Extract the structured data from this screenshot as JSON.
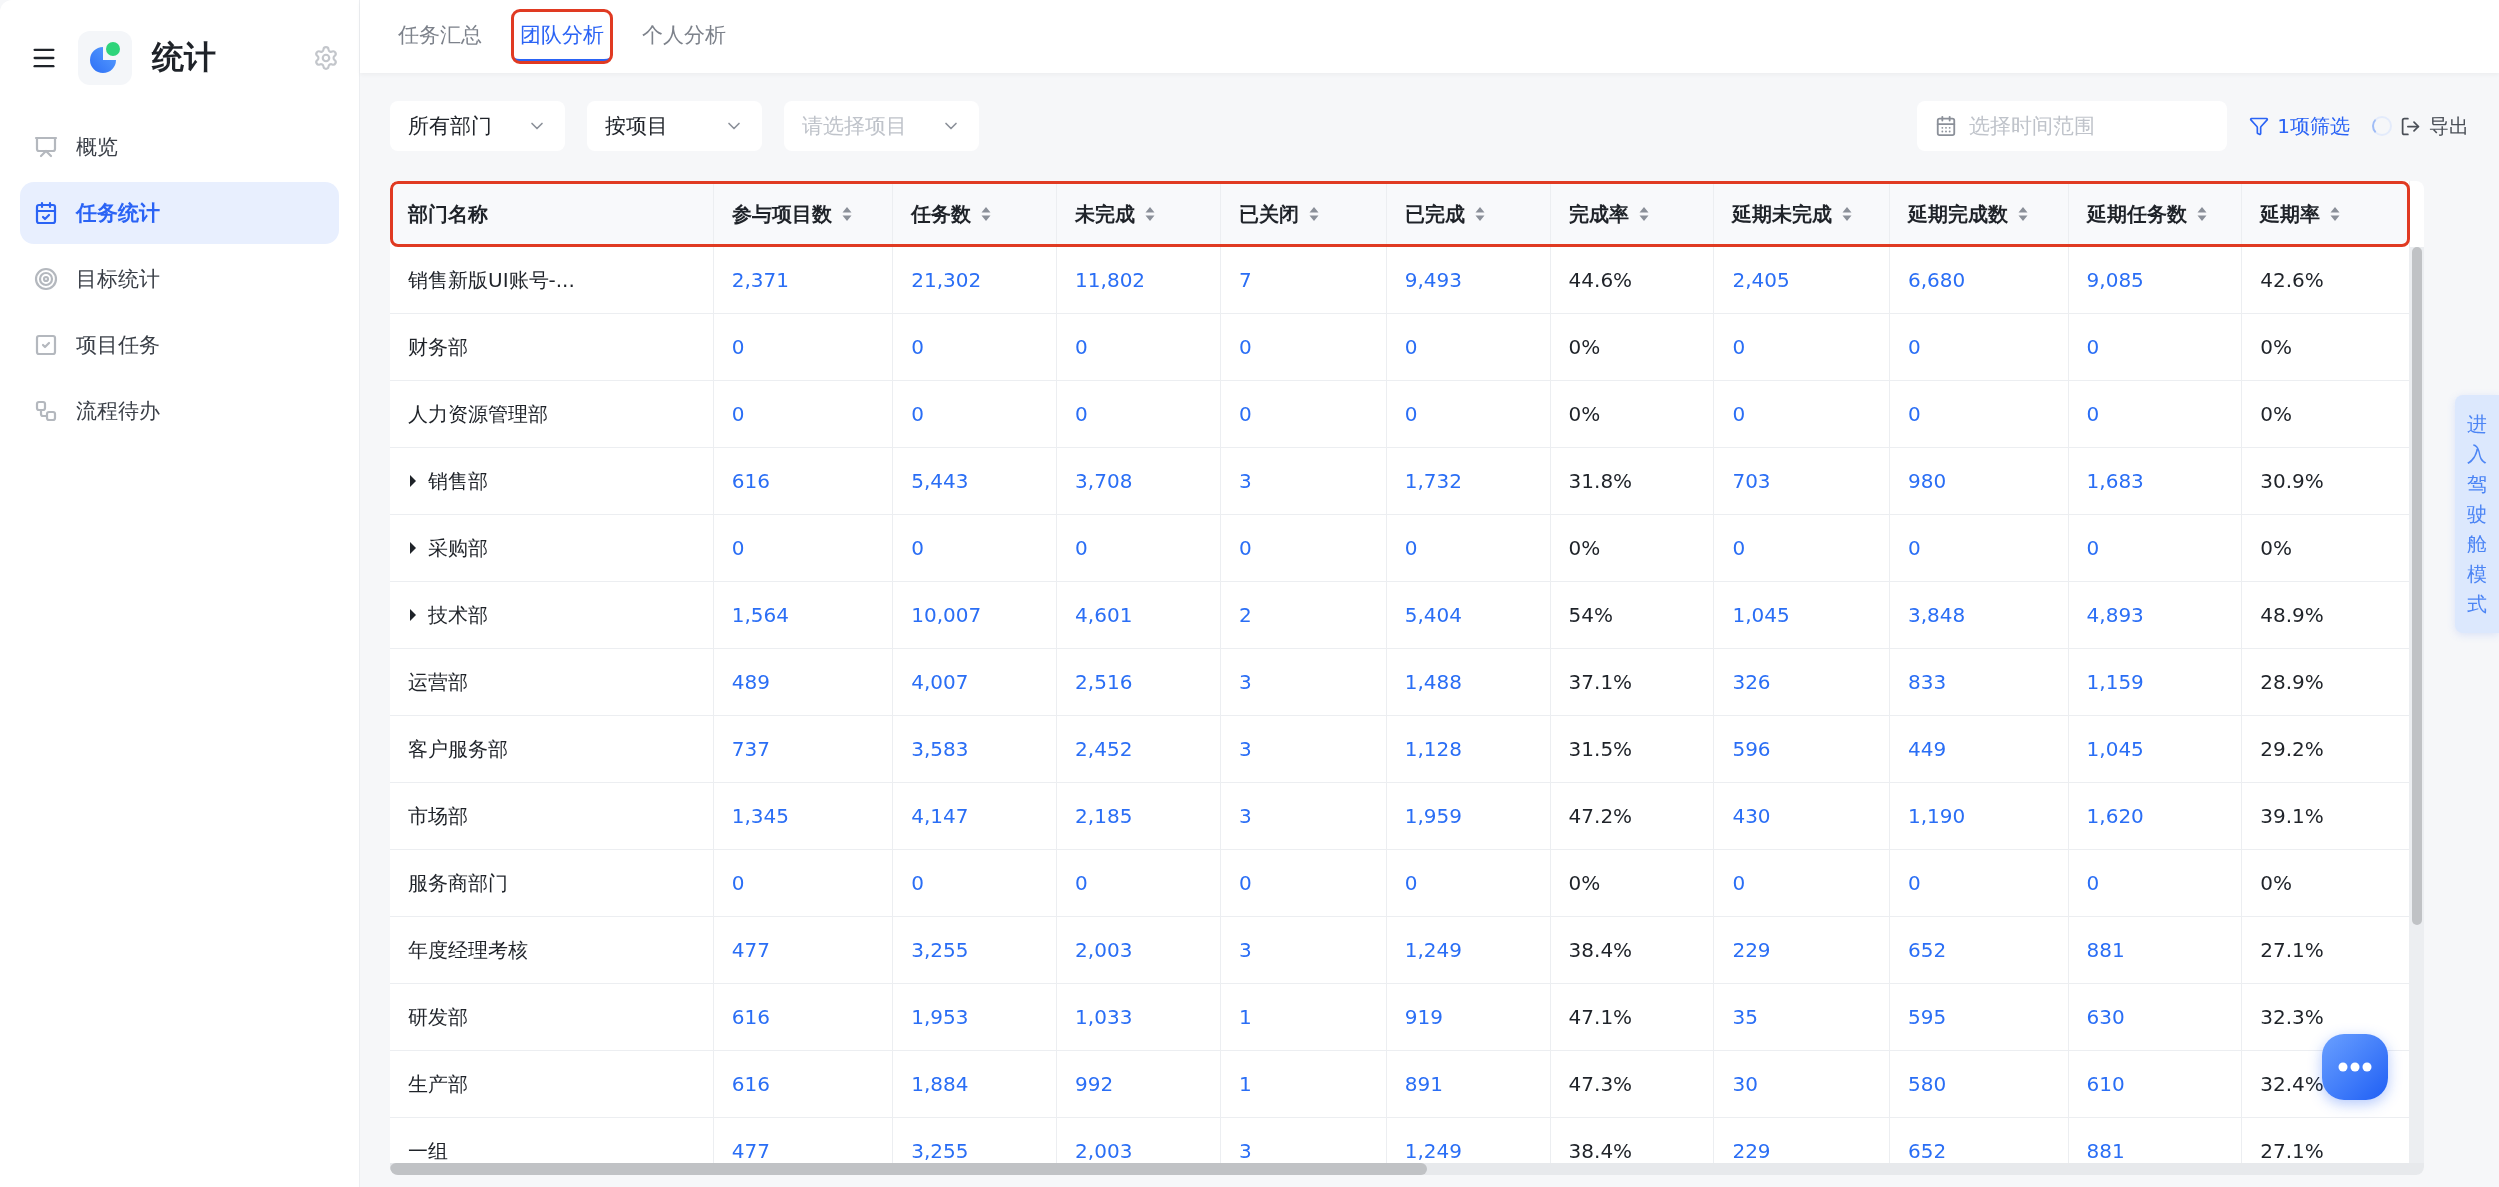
{
  "sidebar": {
    "title": "统计",
    "items": [
      {
        "label": "概览",
        "kind": "presentation",
        "selected": false
      },
      {
        "label": "任务统计",
        "kind": "calendar",
        "selected": true
      },
      {
        "label": "目标统计",
        "kind": "target",
        "selected": false
      },
      {
        "label": "项目任务",
        "kind": "check",
        "selected": false
      },
      {
        "label": "流程待办",
        "kind": "flow",
        "selected": false
      }
    ]
  },
  "tabs": [
    {
      "label": "任务汇总",
      "selected": false,
      "highlighted": false
    },
    {
      "label": "团队分析",
      "selected": true,
      "highlighted": true
    },
    {
      "label": "个人分析",
      "selected": false,
      "highlighted": false
    }
  ],
  "filters": {
    "department": {
      "value": "所有部门"
    },
    "group_by": {
      "value": "按项目"
    },
    "project": {
      "placeholder": "请选择项目"
    },
    "date_range": {
      "placeholder": "选择时间范围"
    },
    "filter_link": "1项筛选",
    "export": "导出"
  },
  "table": {
    "header_highlighted": true,
    "columns": [
      {
        "label": "部门名称",
        "kind": "name",
        "sortable": false
      },
      {
        "label": "参与项目数",
        "kind": "link",
        "sortable": true
      },
      {
        "label": "任务数",
        "kind": "link",
        "sortable": true
      },
      {
        "label": "未完成",
        "kind": "link",
        "sortable": true
      },
      {
        "label": "已关闭",
        "kind": "link",
        "sortable": true
      },
      {
        "label": "已完成",
        "kind": "link",
        "sortable": true
      },
      {
        "label": "完成率",
        "kind": "text",
        "sortable": true
      },
      {
        "label": "延期未完成",
        "kind": "link",
        "sortable": true
      },
      {
        "label": "延期完成数",
        "kind": "link",
        "sortable": true
      },
      {
        "label": "延期任务数",
        "kind": "link",
        "sortable": true
      },
      {
        "label": "延期率",
        "kind": "text",
        "sortable": true
      }
    ],
    "rows": [
      {
        "kind": "leaf",
        "cells": [
          "销售新版UI账号-...",
          "2,371",
          "21,302",
          "11,802",
          "7",
          "9,493",
          "44.6%",
          "2,405",
          "6,680",
          "9,085",
          "42.6%"
        ]
      },
      {
        "kind": "leaf",
        "cells": [
          "财务部",
          "0",
          "0",
          "0",
          "0",
          "0",
          "0%",
          "0",
          "0",
          "0",
          "0%"
        ]
      },
      {
        "kind": "leaf",
        "cells": [
          "人力资源管理部",
          "0",
          "0",
          "0",
          "0",
          "0",
          "0%",
          "0",
          "0",
          "0",
          "0%"
        ]
      },
      {
        "kind": "group",
        "expanded": false,
        "cells": [
          "销售部",
          "616",
          "5,443",
          "3,708",
          "3",
          "1,732",
          "31.8%",
          "703",
          "980",
          "1,683",
          "30.9%"
        ]
      },
      {
        "kind": "group",
        "expanded": false,
        "cells": [
          "采购部",
          "0",
          "0",
          "0",
          "0",
          "0",
          "0%",
          "0",
          "0",
          "0",
          "0%"
        ]
      },
      {
        "kind": "group",
        "expanded": false,
        "cells": [
          "技术部",
          "1,564",
          "10,007",
          "4,601",
          "2",
          "5,404",
          "54%",
          "1,045",
          "3,848",
          "4,893",
          "48.9%"
        ]
      },
      {
        "kind": "leaf",
        "cells": [
          "运营部",
          "489",
          "4,007",
          "2,516",
          "3",
          "1,488",
          "37.1%",
          "326",
          "833",
          "1,159",
          "28.9%"
        ]
      },
      {
        "kind": "leaf",
        "cells": [
          "客户服务部",
          "737",
          "3,583",
          "2,452",
          "3",
          "1,128",
          "31.5%",
          "596",
          "449",
          "1,045",
          "29.2%"
        ]
      },
      {
        "kind": "leaf",
        "cells": [
          "市场部",
          "1,345",
          "4,147",
          "2,185",
          "3",
          "1,959",
          "47.2%",
          "430",
          "1,190",
          "1,620",
          "39.1%"
        ]
      },
      {
        "kind": "leaf",
        "cells": [
          "服务商部门",
          "0",
          "0",
          "0",
          "0",
          "0",
          "0%",
          "0",
          "0",
          "0",
          "0%"
        ]
      },
      {
        "kind": "leaf",
        "cells": [
          "年度经理考核",
          "477",
          "3,255",
          "2,003",
          "3",
          "1,249",
          "38.4%",
          "229",
          "652",
          "881",
          "27.1%"
        ]
      },
      {
        "kind": "leaf",
        "cells": [
          "研发部",
          "616",
          "1,953",
          "1,033",
          "1",
          "919",
          "47.1%",
          "35",
          "595",
          "630",
          "32.3%"
        ]
      },
      {
        "kind": "leaf",
        "cells": [
          "生产部",
          "616",
          "1,884",
          "992",
          "1",
          "891",
          "47.3%",
          "30",
          "580",
          "610",
          "32.4%"
        ]
      },
      {
        "kind": "leaf",
        "cells": [
          "一组",
          "477",
          "3,255",
          "2,003",
          "3",
          "1,249",
          "38.4%",
          "229",
          "652",
          "881",
          "27.1%"
        ]
      }
    ]
  },
  "cockpit_tab": "进入驾驶舱模式"
}
